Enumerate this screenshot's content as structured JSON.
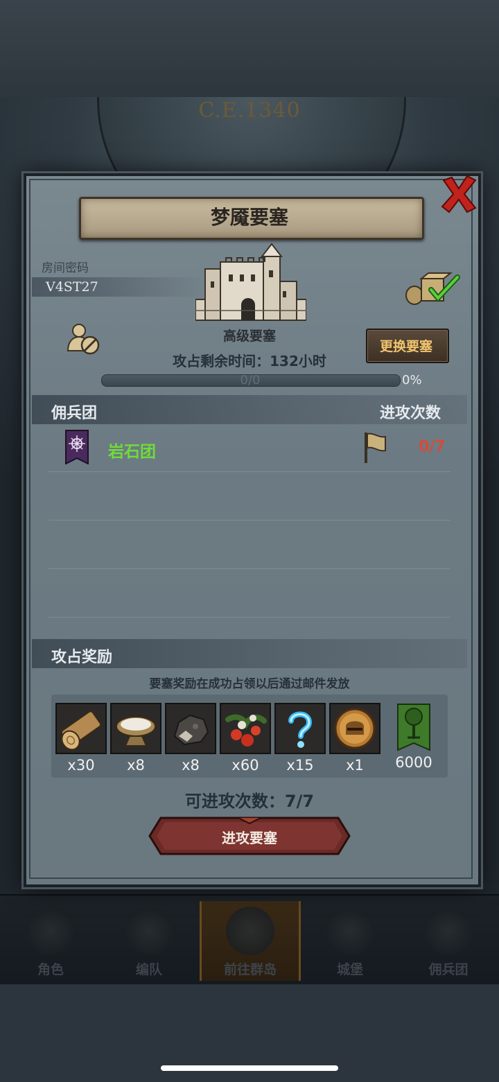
{
  "background": {
    "era": "C.E.1340"
  },
  "dialog": {
    "title": "梦魇要塞",
    "room": {
      "label": "房间密码",
      "code": "V4ST27"
    },
    "fortress_grade": "高级要塞",
    "time_remaining": "攻占剩余时间：132小时",
    "progress": {
      "value_text": "0/0",
      "percent_text": "0%",
      "fraction": 0
    },
    "change_button": "更换要塞",
    "mercenary_section": {
      "title": "佣兵团",
      "attack_count_title": "进攻次数",
      "rows": [
        {
          "name": "岩石团",
          "attacks": "0/7"
        }
      ]
    },
    "reward_section": {
      "title": "攻占奖励",
      "note": "要塞奖励在成功占领以后通过邮件发放",
      "items": [
        {
          "icon": "wood-log-icon",
          "qty": "x30"
        },
        {
          "icon": "salt-bowl-icon",
          "qty": "x8"
        },
        {
          "icon": "ore-rock-icon",
          "qty": "x8"
        },
        {
          "icon": "berry-bush-icon",
          "qty": "x60"
        },
        {
          "icon": "mystery-question-icon",
          "qty": "x15"
        },
        {
          "icon": "knight-helmet-coin-icon",
          "qty": "x1"
        },
        {
          "icon": "guild-tree-banner-icon",
          "qty": "6000"
        }
      ]
    },
    "attacks_left": "可进攻次数：7/7",
    "attack_button": "进攻要塞"
  },
  "nav": {
    "items": [
      {
        "label": "角色"
      },
      {
        "label": "编队"
      },
      {
        "label": "前往群岛"
      },
      {
        "label": "城堡"
      },
      {
        "label": "佣兵团"
      }
    ],
    "active_index": 2
  },
  "colors": {
    "merc_name": "#6fdc3a",
    "attacks_red": "#d24c3c",
    "change_label": "#f1c46e",
    "close_red": "#c0221c"
  }
}
